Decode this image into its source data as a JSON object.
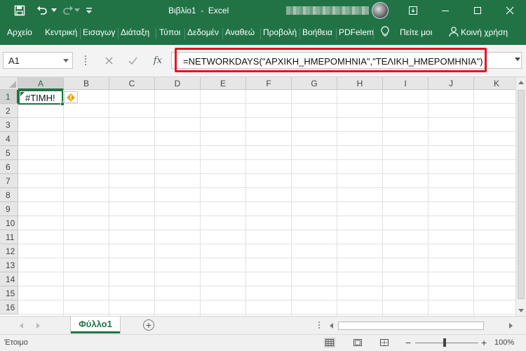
{
  "window": {
    "title": "Βιβλίο1  -  Excel",
    "minimize_label": "minimize",
    "maximize_label": "maximize",
    "close_label": "close"
  },
  "quick_access": {
    "save": "save-icon",
    "undo": "undo-icon",
    "redo": "redo-icon",
    "customize": "customize-icon"
  },
  "ribbon": {
    "tabs": [
      {
        "label": "Αρχείο"
      },
      {
        "label": "Κεντρική"
      },
      {
        "label": "Εισαγωγ"
      },
      {
        "label": "Διάταξη"
      },
      {
        "label": "Τύποι"
      },
      {
        "label": "Δεδομέν"
      },
      {
        "label": "Αναθεώ"
      },
      {
        "label": "Προβολή"
      },
      {
        "label": "Βοήθεια"
      },
      {
        "label": "PDFelem"
      }
    ],
    "tell_me": "Πείτε μοι",
    "share": "Κοινή χρήση"
  },
  "formula_bar": {
    "name_box": "A1",
    "formula": "=NETWORKDAYS(\"ΑΡΧΙΚΗ_ΗΜΕΡΟΜΗΝΙΑ\",\"ΤΕΛΙΚΗ_ΗΜΕΡΟΜΗΝΙΑ\")",
    "fx_label": "fx",
    "highlight_color": "#e81123"
  },
  "grid": {
    "columns": [
      "A",
      "B",
      "C",
      "D",
      "E",
      "F",
      "G",
      "H",
      "I",
      "J",
      "K"
    ],
    "rows": [
      "1",
      "2",
      "3",
      "4",
      "5",
      "6",
      "7",
      "8",
      "9",
      "10",
      "11",
      "12",
      "13",
      "14",
      "15",
      "16"
    ],
    "active_cell": "A1",
    "cells": {
      "A1": "#ΤΙΜΗ!"
    }
  },
  "sheets": {
    "tabs": [
      {
        "label": "Φύλλο1"
      }
    ],
    "add_label": "+"
  },
  "status_bar": {
    "ready": "Έτοιμο",
    "zoom": "100%"
  },
  "colors": {
    "accent": "#217346",
    "error_icon": "#f0a30a"
  }
}
